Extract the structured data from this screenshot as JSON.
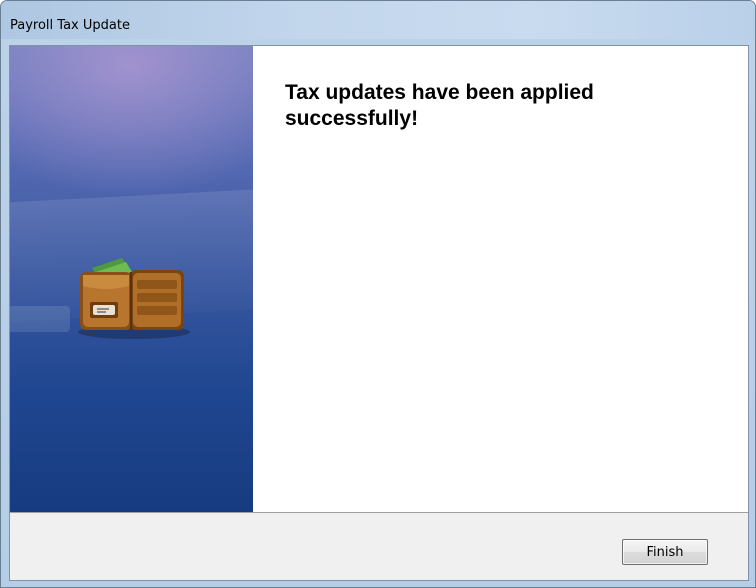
{
  "window": {
    "title": "Payroll Tax Update"
  },
  "main": {
    "message": "Tax updates have been applied successfully!"
  },
  "side_panel": {
    "illustration": "wallet-icon"
  },
  "footer": {
    "finish_label": "Finish"
  },
  "colors": {
    "side_panel_top": "#6f7fbe",
    "side_panel_bottom": "#173b80",
    "title_bar": "#c2d6ec",
    "footer_bg": "#f0f0f0"
  }
}
